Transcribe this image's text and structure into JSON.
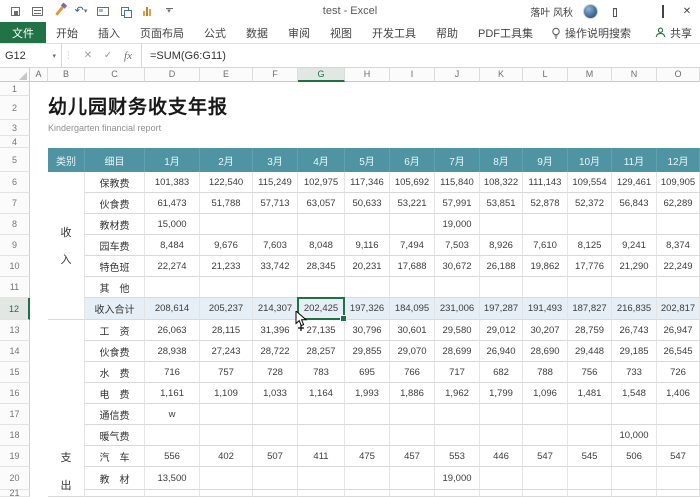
{
  "titlebar": {
    "title": "test - Excel",
    "user": "落叶 风秋"
  },
  "ribbon": {
    "tabs": [
      "文件",
      "开始",
      "插入",
      "页面布局",
      "公式",
      "数据",
      "审阅",
      "视图",
      "开发工具",
      "帮助",
      "PDF工具集"
    ],
    "search": "操作说明搜索",
    "share": "共享"
  },
  "formula_bar": {
    "name_box": "G12",
    "formula": "=SUM(G6:G11)"
  },
  "sheet": {
    "col_letters": [
      "A",
      "B",
      "C",
      "D",
      "E",
      "F",
      "G",
      "H",
      "I",
      "J",
      "K",
      "L",
      "M",
      "N",
      "O"
    ],
    "row_numbers": [
      "1",
      "2",
      "3",
      "4",
      "5",
      "6",
      "7",
      "8",
      "9",
      "10",
      "11",
      "12",
      "13",
      "14",
      "15",
      "16",
      "17",
      "18",
      "19",
      "20",
      "21"
    ],
    "title": "幼儿园财务收支年报",
    "subtitle": "Kindergarten financial report",
    "selection": {
      "cell": "G12"
    },
    "table": {
      "category_header": "类别",
      "item_header": "细目",
      "months": [
        "1月",
        "2月",
        "3月",
        "4月",
        "5月",
        "6月",
        "7月",
        "8月",
        "9月",
        "10月",
        "11月",
        "12月"
      ],
      "sections": [
        {
          "label": "收入",
          "chars": [
            "收",
            "入"
          ]
        },
        {
          "label": "支出",
          "chars": [
            "支",
            "出"
          ]
        }
      ],
      "rows": [
        {
          "section": 0,
          "item": "保教费",
          "values": [
            "101,383",
            "122,540",
            "115,249",
            "102,975",
            "117,346",
            "105,692",
            "115,840",
            "108,322",
            "111,143",
            "109,554",
            "129,461",
            "109,905"
          ]
        },
        {
          "section": 0,
          "item": "伙食费",
          "values": [
            "61,473",
            "51,788",
            "57,713",
            "63,057",
            "50,633",
            "53,221",
            "57,991",
            "53,851",
            "52,878",
            "52,372",
            "56,843",
            "62,289"
          ]
        },
        {
          "section": 0,
          "item": "教材费",
          "values": [
            "15,000",
            "",
            "",
            "",
            "",
            "",
            "19,000",
            "",
            "",
            "",
            "",
            ""
          ]
        },
        {
          "section": 0,
          "item": "园车费",
          "values": [
            "8,484",
            "9,676",
            "7,603",
            "8,048",
            "9,116",
            "7,494",
            "7,503",
            "8,926",
            "7,610",
            "8,125",
            "9,241",
            "8,374"
          ]
        },
        {
          "section": 0,
          "item": "特色班",
          "values": [
            "22,274",
            "21,233",
            "33,742",
            "28,345",
            "20,231",
            "17,688",
            "30,672",
            "26,188",
            "19,862",
            "17,776",
            "21,290",
            "22,249"
          ]
        },
        {
          "section": 0,
          "item": "其　他",
          "values": [
            "",
            "",
            "",
            "",
            "",
            "",
            "",
            "",
            "",
            "",
            "",
            ""
          ]
        },
        {
          "section": 0,
          "item": "收入合计",
          "total": true,
          "values": [
            "208,614",
            "205,237",
            "214,307",
            "202,425",
            "197,326",
            "184,095",
            "231,006",
            "197,287",
            "191,493",
            "187,827",
            "216,835",
            "202,817"
          ]
        },
        {
          "section": 1,
          "item": "工　资",
          "values": [
            "26,063",
            "28,115",
            "31,396",
            "27,135",
            "30,796",
            "30,601",
            "29,580",
            "29,012",
            "30,207",
            "28,759",
            "26,743",
            "26,947"
          ]
        },
        {
          "section": 1,
          "item": "伙食费",
          "values": [
            "28,938",
            "27,243",
            "28,722",
            "28,257",
            "29,855",
            "29,070",
            "28,699",
            "26,940",
            "28,690",
            "29,448",
            "29,185",
            "26,545"
          ]
        },
        {
          "section": 1,
          "item": "水　费",
          "values": [
            "716",
            "757",
            "728",
            "783",
            "695",
            "766",
            "717",
            "682",
            "788",
            "756",
            "733",
            "726"
          ]
        },
        {
          "section": 1,
          "item": "电　费",
          "values": [
            "1,161",
            "1,109",
            "1,033",
            "1,164",
            "1,993",
            "1,886",
            "1,962",
            "1,799",
            "1,096",
            "1,481",
            "1,548",
            "1,406"
          ]
        },
        {
          "section": 1,
          "item": "通信费",
          "values": [
            "w",
            "",
            "",
            "",
            "",
            "",
            "",
            "",
            "",
            "",
            "",
            ""
          ]
        },
        {
          "section": 1,
          "item": "暖气费",
          "values": [
            "",
            "",
            "",
            "",
            "",
            "",
            "",
            "",
            "",
            "",
            "10,000",
            ""
          ]
        },
        {
          "section": 1,
          "item": "汽　车",
          "values": [
            "556",
            "402",
            "507",
            "411",
            "475",
            "457",
            "553",
            "446",
            "547",
            "545",
            "506",
            "547"
          ]
        },
        {
          "section": 1,
          "item": "教　材",
          "values": [
            "13,500",
            "",
            "",
            "",
            "",
            "",
            "19,000",
            "",
            "",
            "",
            "",
            ""
          ]
        }
      ]
    }
  }
}
